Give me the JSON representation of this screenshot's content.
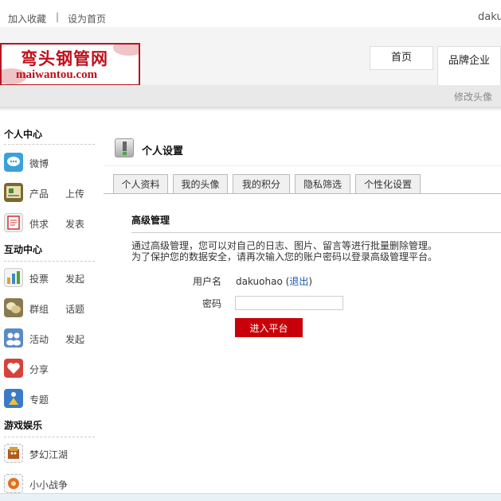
{
  "topbar": {
    "bookmark": "加入收藏",
    "separator": "|",
    "set_home": "设为首页",
    "username": "daku"
  },
  "logo": {
    "cn": "弯头钢管网",
    "en": "maiwantou.com"
  },
  "nav": {
    "home": "首页",
    "brand": "品牌企业"
  },
  "subbar": {
    "change_avatar": "修改头像"
  },
  "sidebar": {
    "sections": [
      {
        "title": "个人中心",
        "items": [
          {
            "l1": "微博",
            "l2": "",
            "icon": "weibo-icon"
          },
          {
            "l1": "产品",
            "l2": "上传",
            "icon": "product-icon"
          },
          {
            "l1": "供求",
            "l2": "发表",
            "icon": "supply-icon"
          }
        ]
      },
      {
        "title": "互动中心",
        "items": [
          {
            "l1": "投票",
            "l2": "发起",
            "icon": "vote-icon"
          },
          {
            "l1": "群组",
            "l2": "话题",
            "icon": "group-icon"
          },
          {
            "l1": "活动",
            "l2": "发起",
            "icon": "event-icon"
          },
          {
            "l1": "分享",
            "l2": "",
            "icon": "heart-icon"
          },
          {
            "l1": "专题",
            "l2": "",
            "icon": "topic-icon"
          }
        ]
      },
      {
        "title": "游戏娱乐",
        "items": [
          {
            "l1": "梦幻江湖",
            "l2": "",
            "icon": "game-jianghu-icon"
          },
          {
            "l1": "小小战争",
            "l2": "",
            "icon": "game-war-icon"
          }
        ]
      }
    ]
  },
  "main": {
    "title": "个人设置",
    "tabs": [
      "个人资料",
      "我的头像",
      "我的积分",
      "隐私筛选",
      "个性化设置"
    ],
    "panel_title": "高级管理",
    "desc_line1": "通过高级管理，您可以对自己的日志、图片、留言等进行批量删除管理。",
    "desc_line2": "为了保护您的数据安全，请再次输入您的账户密码以登录高级管理平台。",
    "username_label": "用户名",
    "username_value": "dakuohao",
    "logout_open": " (",
    "logout": "退出",
    "logout_close": ")",
    "password_label": "密码",
    "password_value": "",
    "enter_button": "进入平台"
  },
  "colors": {
    "accent": "#c8000a",
    "link": "#1e5aa8",
    "logo": "#c0101c"
  }
}
